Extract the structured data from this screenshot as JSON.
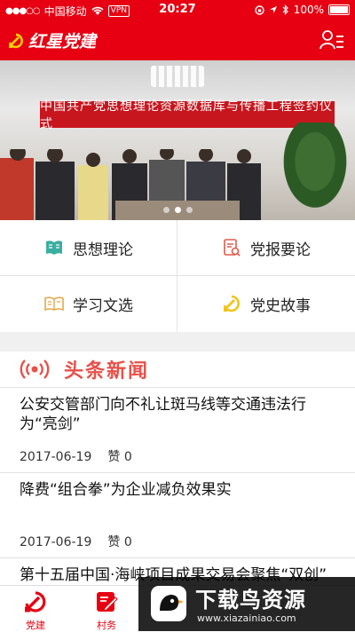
{
  "status_bar": {
    "carrier": "中国移动",
    "vpn": "VPN",
    "time": "20:27",
    "battery": "100%"
  },
  "header": {
    "app_name": "红星党建"
  },
  "banner": {
    "caption": "中国共产党思想理论资源数据库与传播工程签约仪式",
    "page_count": 3,
    "active_page": 2
  },
  "menu": {
    "items": [
      {
        "label": "思想理论",
        "icon": "book-icon"
      },
      {
        "label": "党报要论",
        "icon": "document-search-icon"
      },
      {
        "label": "学习文选",
        "icon": "open-book-icon"
      },
      {
        "label": "党史故事",
        "icon": "party-emblem-icon"
      }
    ]
  },
  "section": {
    "title": "头条新闻",
    "icon": "broadcast-icon"
  },
  "news": {
    "items": [
      {
        "title": "公安交管部门向不礼让斑马线等交通违法行为“亮剑”",
        "date": "2017-06-19",
        "likes": "赞 0"
      },
      {
        "title": "降费“组合拳”为企业减负效果实",
        "date": "2017-06-19",
        "likes": "赞 0"
      },
      {
        "title": "第十五届中国·海峡项目成果交易会聚焦“双创”",
        "date": "",
        "likes": ""
      }
    ]
  },
  "tabbar": {
    "items": [
      {
        "label": "党建",
        "icon": "party-emblem-icon"
      },
      {
        "label": "村务",
        "icon": "edit-icon"
      }
    ]
  },
  "watermark": {
    "text": "下载鸟资源",
    "url": "www.xiazainiao.com"
  },
  "colors": {
    "brand_red": "#e60012",
    "section_red": "#e8504a"
  }
}
